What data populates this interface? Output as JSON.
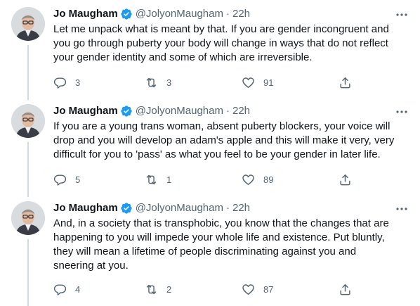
{
  "tweets": [
    {
      "author": "Jo Maugham",
      "handle": "@JolyonMaugham",
      "separator": "·",
      "time": "22h",
      "text": "Let me unpack what is meant by that. If you are gender incongruent and you go through puberty your body will change in ways that do not reflect your gender identity and some of which are irreversible.",
      "replies": "3",
      "retweets": "3",
      "likes": "91"
    },
    {
      "author": "Jo Maugham",
      "handle": "@JolyonMaugham",
      "separator": "·",
      "time": "22h",
      "text": "If you are a young trans woman, absent puberty blockers, your voice will drop and you will develop an adam's apple and this will make it very, very difficult for you to 'pass' as what you feel to be your gender in later life.",
      "replies": "5",
      "retweets": "1",
      "likes": "89"
    },
    {
      "author": "Jo Maugham",
      "handle": "@JolyonMaugham",
      "separator": "·",
      "time": "22h",
      "text": "And, in a society that is transphobic, you know that the changes that are happening to you will impede your whole life and existence. Put bluntly, they will mean a lifetime of people discriminating against you and sneering at you.",
      "replies": "4",
      "retweets": "2",
      "likes": "87"
    }
  ],
  "icons": {
    "verified": "verified-badge-icon",
    "more": "more-icon",
    "reply": "reply-icon",
    "retweet": "retweet-icon",
    "like": "like-icon",
    "share": "share-icon"
  },
  "colors": {
    "verified": "#1d9bf0",
    "secondary_text": "#536471",
    "thread_line": "#cfd9de"
  }
}
